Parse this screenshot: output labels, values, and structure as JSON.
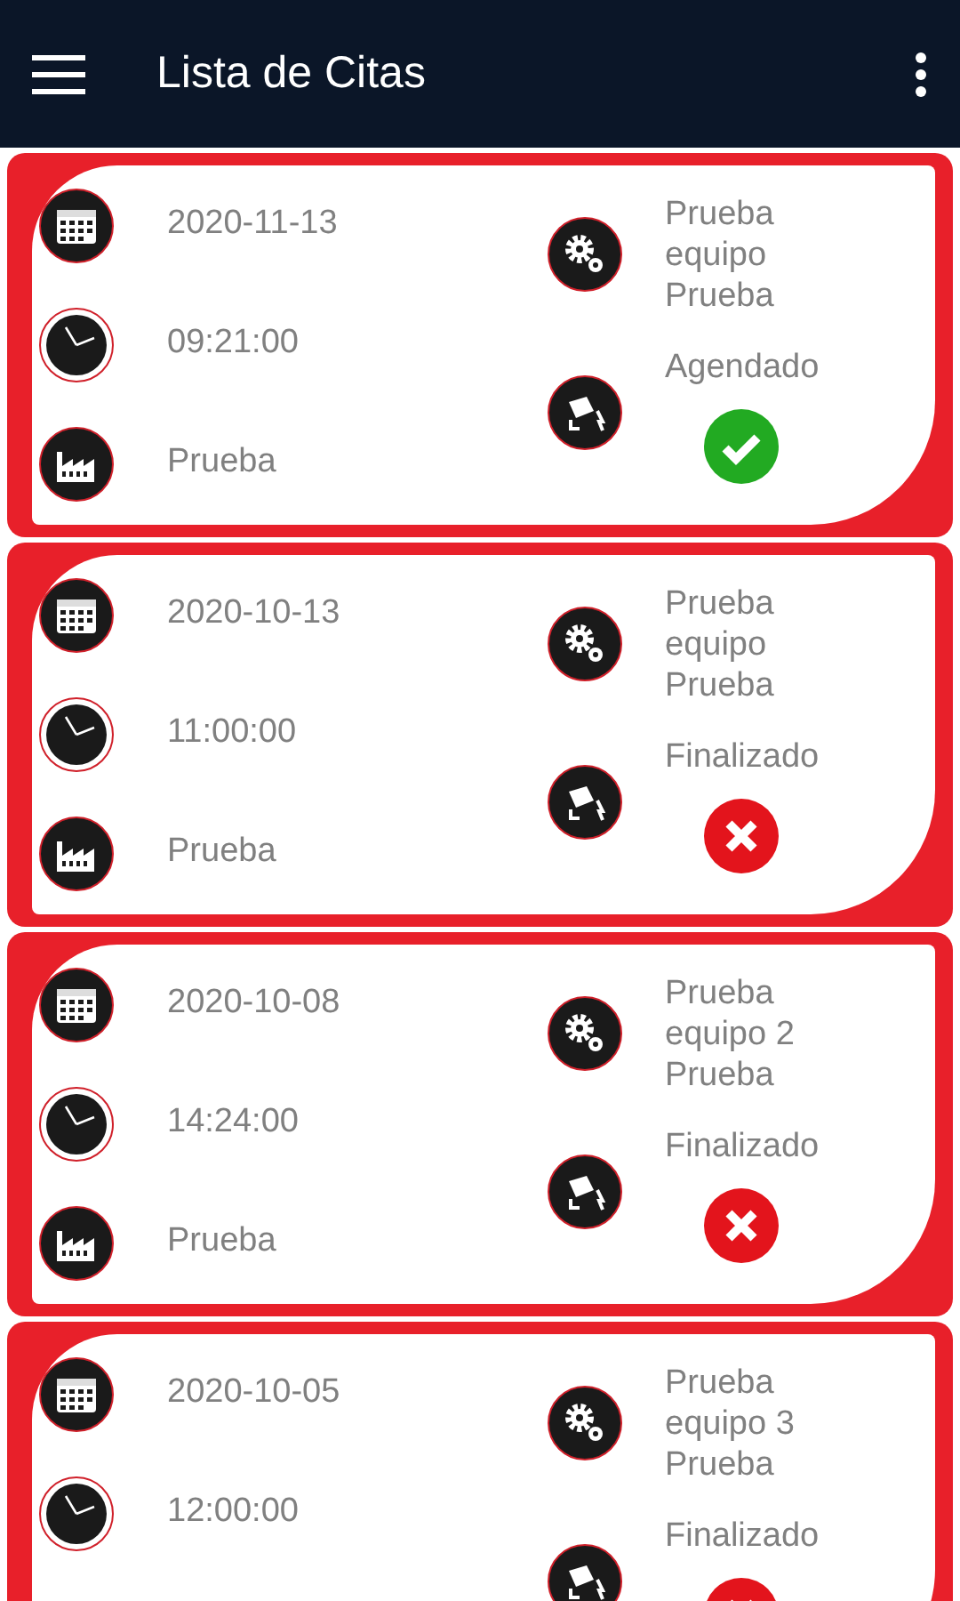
{
  "app_bar": {
    "title": "Lista de Citas"
  },
  "appointments": [
    {
      "date": "2020-11-13",
      "time": "09:21:00",
      "plant": "Prueba",
      "equipment": "Prueba\nequipo\nPrueba",
      "status": "Agendado",
      "finished": false
    },
    {
      "date": "2020-10-13",
      "time": "11:00:00",
      "plant": "Prueba",
      "equipment": "Prueba\nequipo\nPrueba",
      "status": "Finalizado",
      "finished": true
    },
    {
      "date": "2020-10-08",
      "time": "14:24:00",
      "plant": "Prueba",
      "equipment": "Prueba\nequipo 2\nPrueba",
      "status": "Finalizado",
      "finished": true
    },
    {
      "date": "2020-10-05",
      "time": "12:00:00",
      "equipment": "Prueba\nequipo 3\nPrueba",
      "status": "Finalizado",
      "finished": true
    }
  ]
}
